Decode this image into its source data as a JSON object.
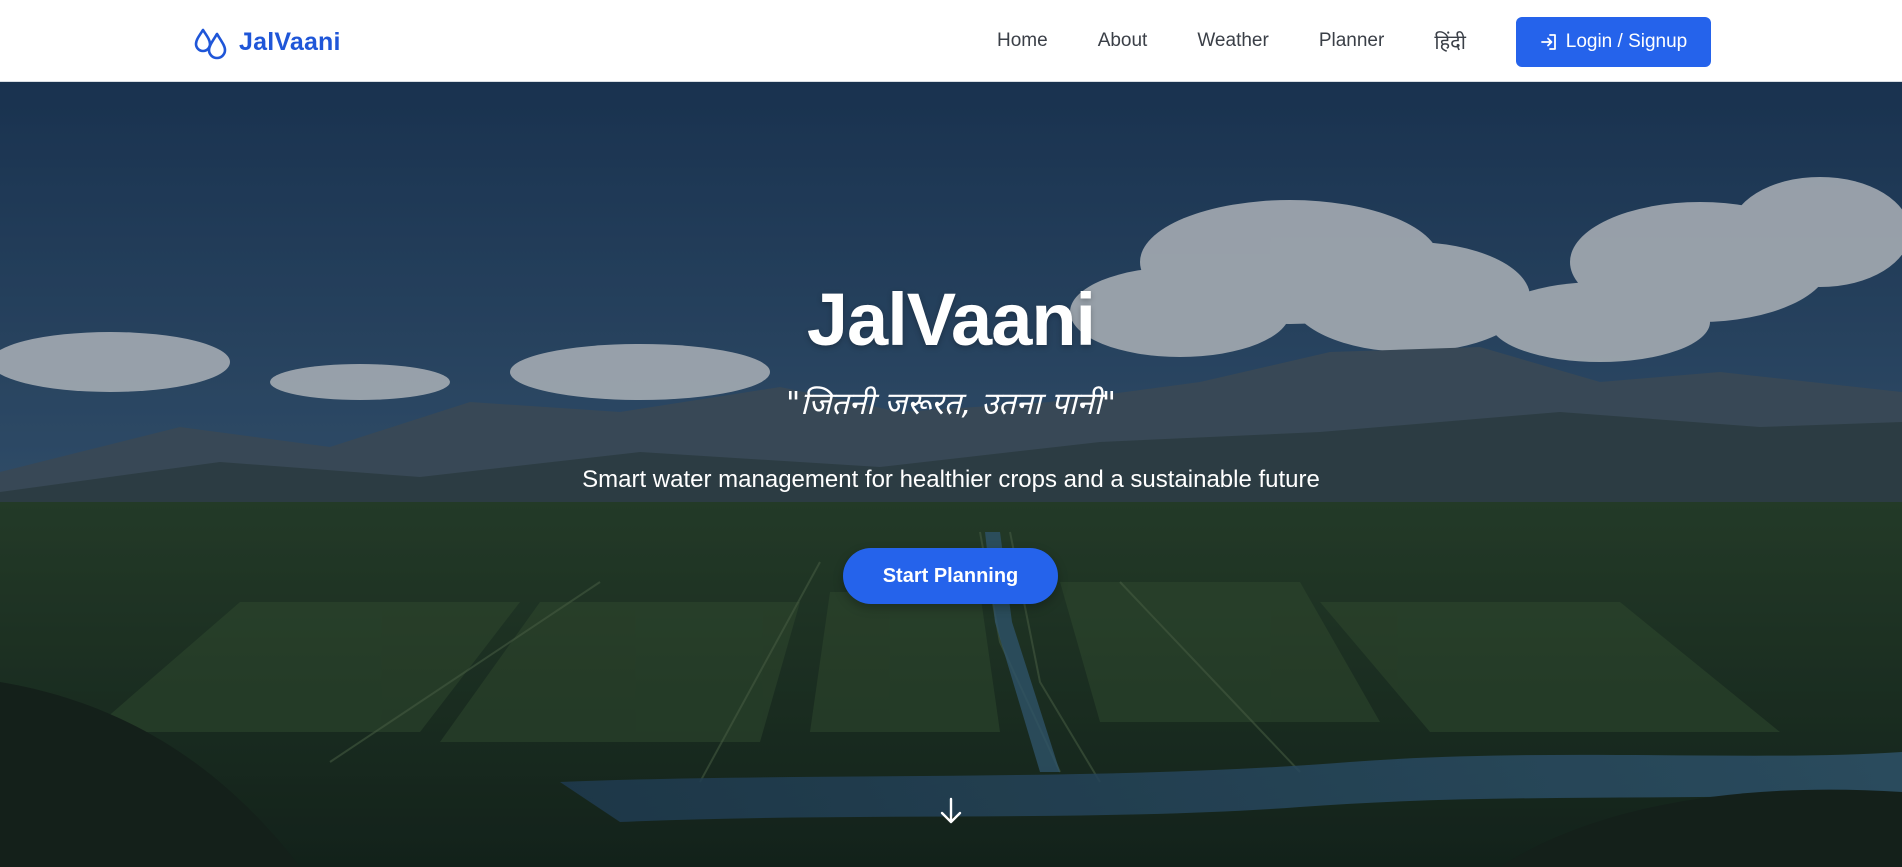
{
  "brand": {
    "name": "JalVaani",
    "icon": "water-drops-icon",
    "color": "#1f56d8"
  },
  "nav": {
    "items": [
      {
        "label": "Home"
      },
      {
        "label": "About"
      },
      {
        "label": "Weather"
      },
      {
        "label": "Planner"
      },
      {
        "label": "हिंदी"
      }
    ],
    "login": {
      "label": "Login / Signup",
      "icon": "login-icon"
    }
  },
  "hero": {
    "title": "JalVaani",
    "tagline": "\"जितनी जरूरत, उतना पानी\"",
    "subtitle": "Smart water management for healthier crops and a sustainable future",
    "cta_label": "Start Planning",
    "scroll_icon": "arrow-down-icon"
  },
  "colors": {
    "accent": "#2563eb",
    "navbar_bg": "#ffffff",
    "text_on_hero": "#ffffff"
  }
}
